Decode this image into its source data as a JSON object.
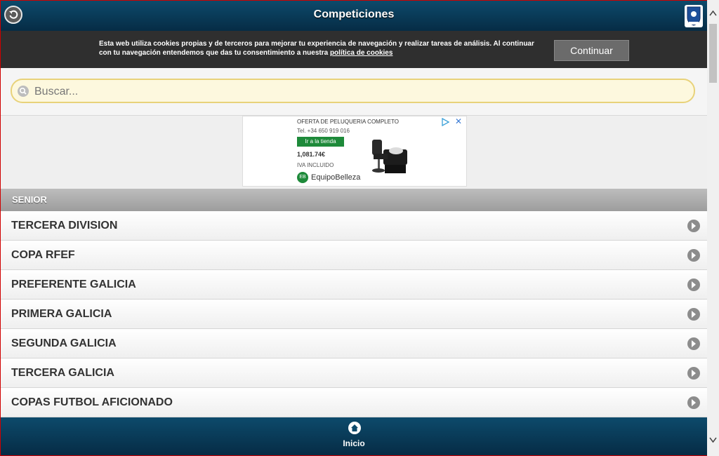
{
  "header": {
    "title": "Competiciones"
  },
  "cookie_bar": {
    "text": "Esta web utiliza cookies propias y de terceros para mejorar tu experiencia de navegación y realizar tareas de análisis. Al continuar con tu navegación entendemos que das tu consentimiento a nuestra",
    "link": "política de cookies",
    "button": "Continuar"
  },
  "search": {
    "placeholder": "Buscar..."
  },
  "ad": {
    "headline": "OFERTA DE PELUQUERIA COMPLETO",
    "phone": "Tel. +34 650 919 016",
    "button": "Ir a la tienda",
    "price": "1,081.74€",
    "tax": "IVA INCLUIDO",
    "brand": "EquipoBelleza",
    "brand_logo": "EB"
  },
  "section": {
    "title": "SENIOR"
  },
  "competitions": [
    {
      "label": "TERCERA DIVISION"
    },
    {
      "label": "COPA RFEF"
    },
    {
      "label": "PREFERENTE GALICIA"
    },
    {
      "label": "PRIMERA GALICIA"
    },
    {
      "label": "SEGUNDA GALICIA"
    },
    {
      "label": "TERCERA GALICIA"
    },
    {
      "label": "COPAS FUTBOL AFICIONADO"
    }
  ],
  "footer": {
    "home_label": "Inicio"
  },
  "colors": {
    "header": "#0d4a6b",
    "cookie_bar": "#2f2f2f",
    "search_bg": "#fdf8de",
    "ad_button": "#1e8a3a"
  },
  "icons": [
    "back-icon",
    "rfgf-logo",
    "search-icon",
    "chevron-right-icon",
    "home-icon",
    "adchoices-icon",
    "close-icon"
  ]
}
